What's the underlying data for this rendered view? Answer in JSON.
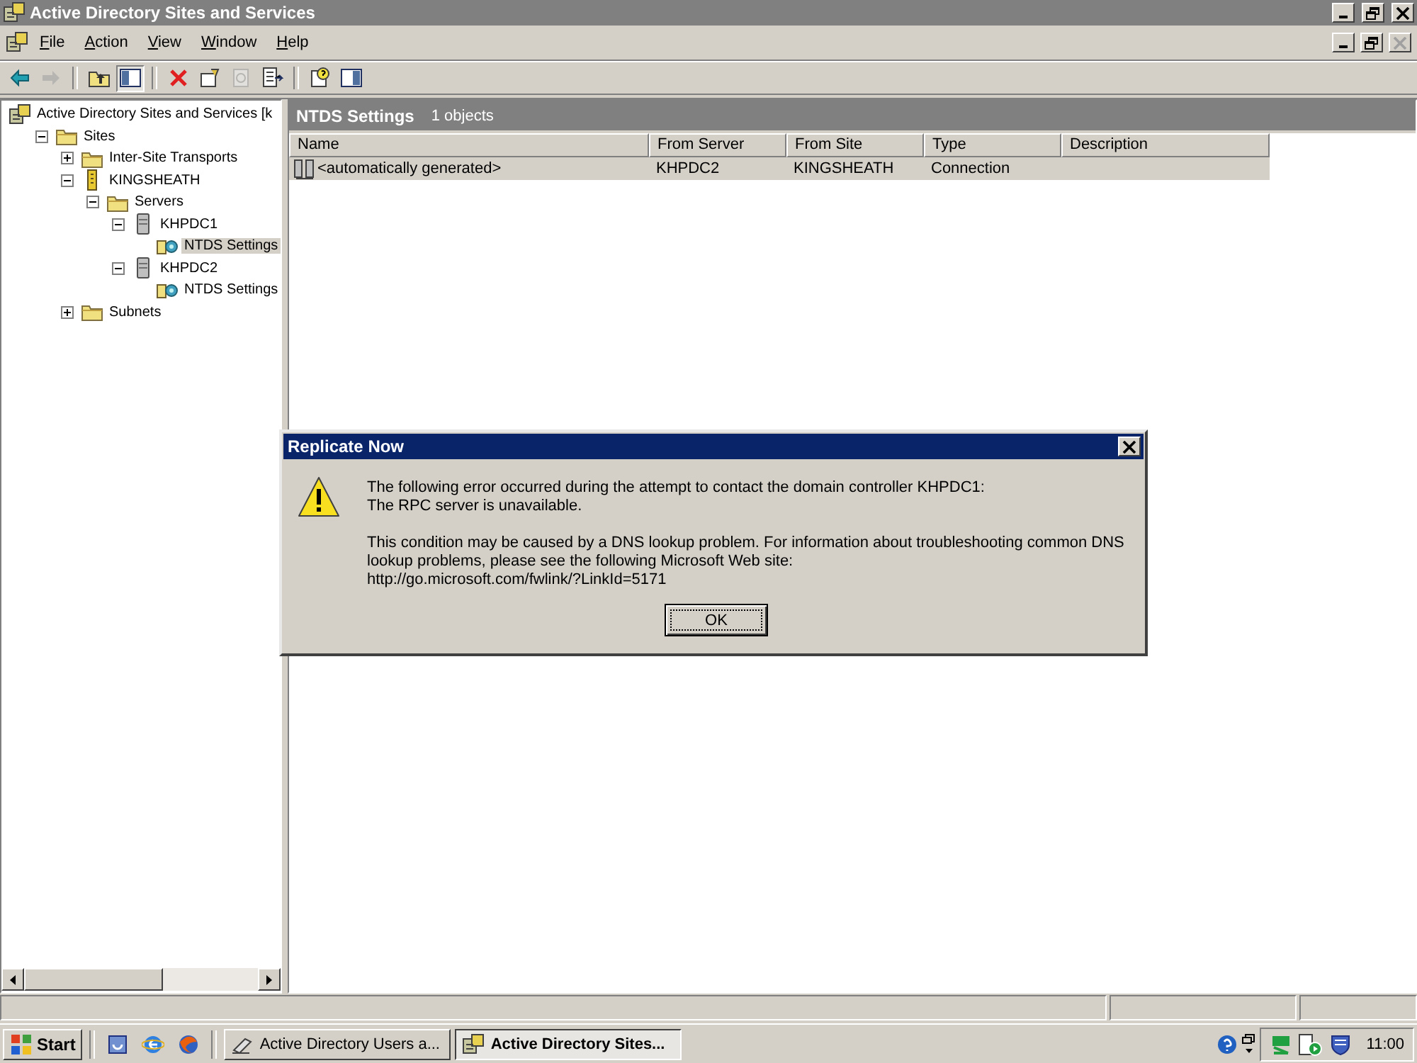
{
  "window": {
    "title": "Active Directory Sites and Services"
  },
  "menu": [
    "File",
    "Action",
    "View",
    "Window",
    "Help"
  ],
  "toolbar": [
    {
      "kind": "back",
      "disabled": false
    },
    {
      "kind": "forward",
      "disabled": true
    },
    {
      "kind": "sep"
    },
    {
      "kind": "up",
      "disabled": false
    },
    {
      "kind": "tree",
      "disabled": false
    },
    {
      "kind": "sep"
    },
    {
      "kind": "delete",
      "disabled": false
    },
    {
      "kind": "properties",
      "disabled": false
    },
    {
      "kind": "refresh",
      "disabled": true
    },
    {
      "kind": "export",
      "disabled": false
    },
    {
      "kind": "sep"
    },
    {
      "kind": "help",
      "disabled": false
    },
    {
      "kind": "pane",
      "disabled": false
    }
  ],
  "tree": [
    {
      "label": "Active Directory Sites and Services [k",
      "kind": "root",
      "selected": false,
      "children": [
        {
          "label": "Sites",
          "kind": "folder",
          "expanded": true,
          "selected": false,
          "children": [
            {
              "label": "Inter-Site Transports",
              "kind": "folder",
              "expanded": false,
              "selected": false
            },
            {
              "label": "KINGSHEATH",
              "kind": "site",
              "expanded": true,
              "selected": false,
              "children": [
                {
                  "label": "Servers",
                  "kind": "folder",
                  "expanded": true,
                  "selected": false,
                  "children": [
                    {
                      "label": "KHPDC1",
                      "kind": "server",
                      "expanded": true,
                      "selected": false,
                      "children": [
                        {
                          "label": "NTDS Settings",
                          "kind": "ntds",
                          "selected": true
                        }
                      ]
                    },
                    {
                      "label": "KHPDC2",
                      "kind": "server",
                      "expanded": true,
                      "selected": false,
                      "children": [
                        {
                          "label": "NTDS Settings",
                          "kind": "ntds",
                          "selected": false
                        }
                      ]
                    }
                  ]
                }
              ]
            },
            {
              "label": "Subnets",
              "kind": "folder",
              "expanded": false,
              "selected": false
            }
          ]
        }
      ]
    }
  ],
  "details": {
    "title": "NTDS Settings",
    "count": "1 objects",
    "columns": [
      "Name",
      "From Server",
      "From Site",
      "Type",
      "Description"
    ],
    "rows": [
      {
        "name": "<automatically generated>",
        "from_server": "KHPDC2",
        "from_site": "KINGSHEATH",
        "type": "Connection",
        "selected": true
      }
    ]
  },
  "dialog": {
    "title": "Replicate Now",
    "paragraphs": [
      "The following error occurred during the attempt to contact the domain controller KHPDC1:\nThe RPC server is unavailable.",
      "This condition may be caused by a DNS lookup problem. For information about troubleshooting common DNS lookup problems, please see the following Microsoft Web site:\nhttp://go.microsoft.com/fwlink/?LinkId=5171"
    ],
    "button": "OK"
  },
  "taskbar": {
    "start": "Start",
    "tasks": [
      {
        "label": "Active Directory Users a...",
        "kind": "users",
        "selected": false
      },
      {
        "label": "Active Directory Sites...",
        "kind": "sites",
        "selected": true
      }
    ],
    "clock": "11:00"
  }
}
